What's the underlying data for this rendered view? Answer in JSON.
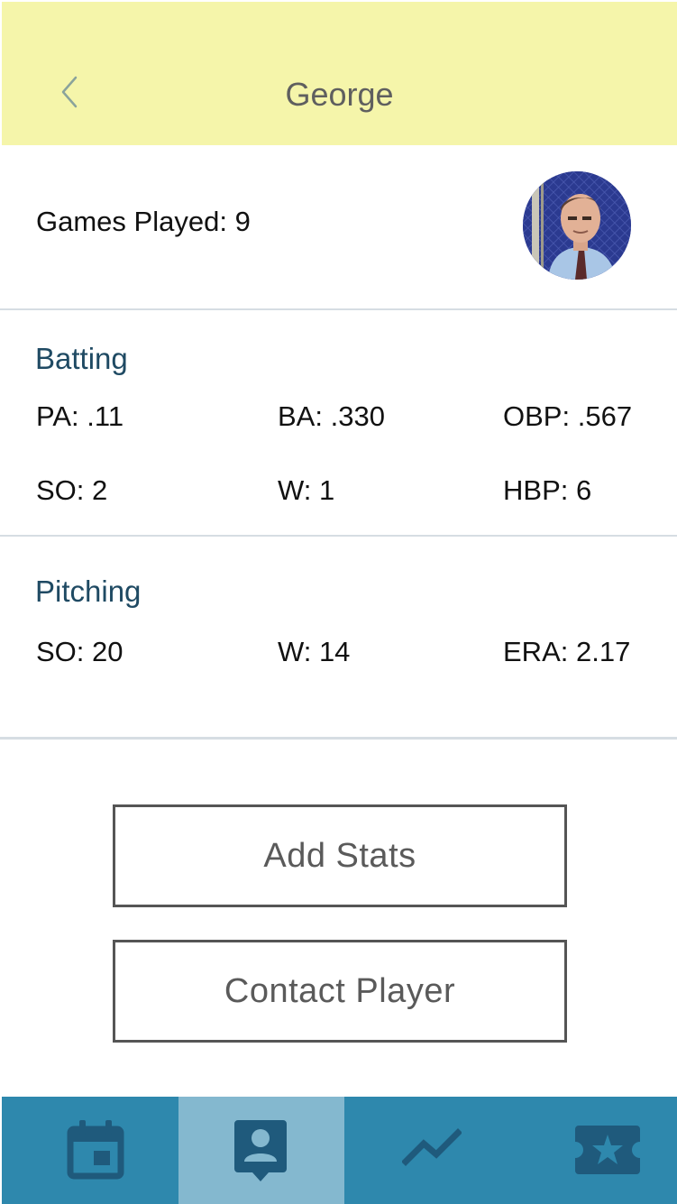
{
  "header": {
    "title": "George",
    "back_icon": "chevron-left-icon"
  },
  "summary": {
    "games_played_label": "Games Played:",
    "games_played_value": "9",
    "avatar_alt": "George"
  },
  "batting": {
    "title": "Batting",
    "stats": [
      {
        "label": "PA:",
        "value": ".11"
      },
      {
        "label": "BA:",
        "value": ".330"
      },
      {
        "label": "OBP:",
        "value": ".567"
      },
      {
        "label": "SO:",
        "value": "2"
      },
      {
        "label": "W:",
        "value": "1"
      },
      {
        "label": "HBP:",
        "value": "6"
      }
    ]
  },
  "pitching": {
    "title": "Pitching",
    "stats": [
      {
        "label": "SO:",
        "value": " 20"
      },
      {
        "label": "W:",
        "value": "14"
      },
      {
        "label": "ERA:",
        "value": "2.17"
      }
    ]
  },
  "actions": {
    "add_stats_label": "Add Stats",
    "contact_player_label": "Contact Player"
  },
  "tabbar": {
    "tabs": [
      {
        "icon": "calendar-icon",
        "active": false
      },
      {
        "icon": "player-profile-icon",
        "active": true
      },
      {
        "icon": "trend-line-icon",
        "active": false
      },
      {
        "icon": "star-ticket-icon",
        "active": false
      }
    ]
  },
  "colors": {
    "header_bg": "#f5f5aa",
    "section_title": "#1f4a63",
    "tabbar_bg": "#2e88ad",
    "tabbar_active": "#84b8cf",
    "tab_icon": "#1f5a7c"
  }
}
